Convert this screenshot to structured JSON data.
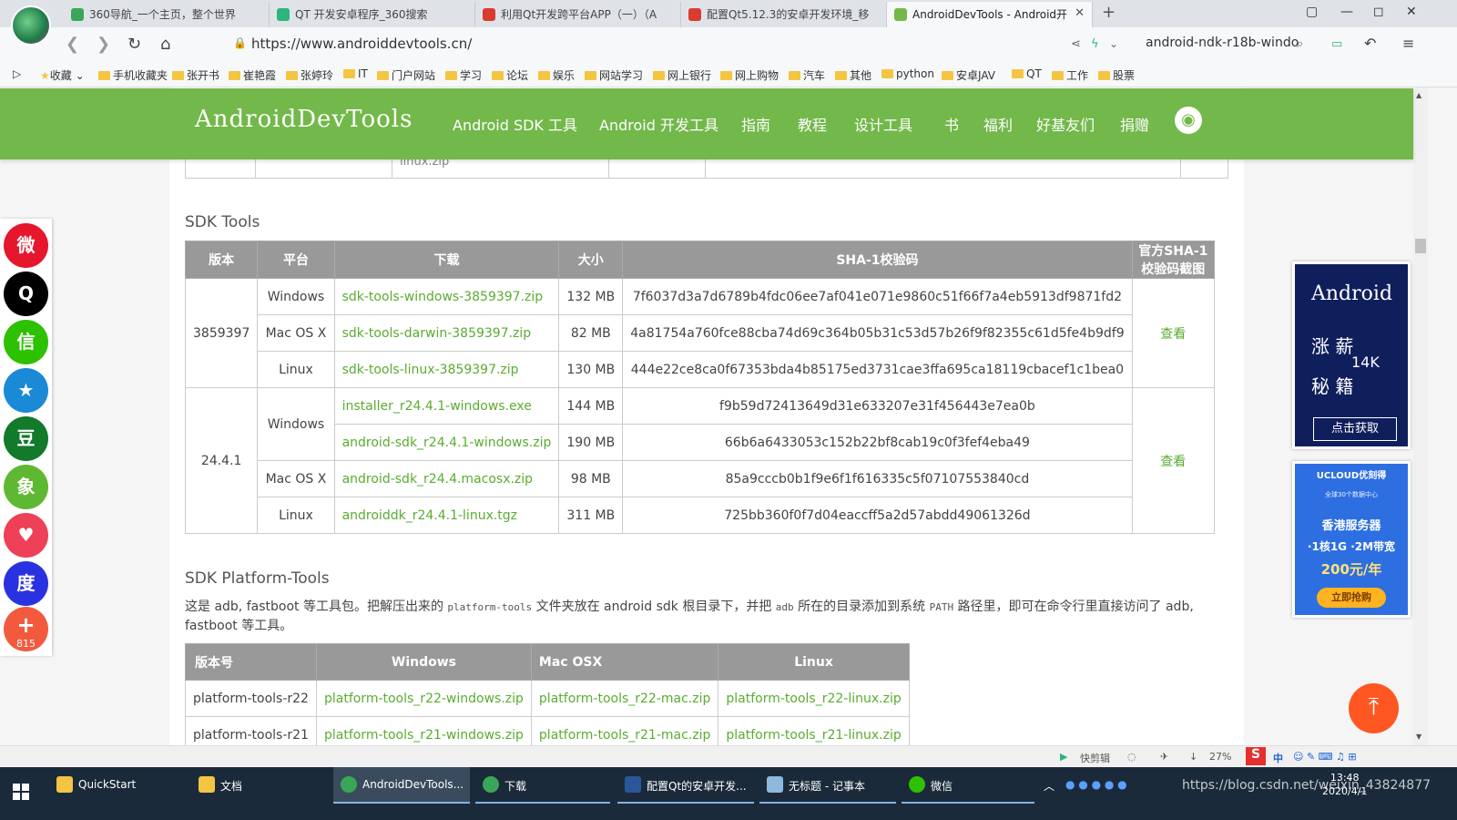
{
  "browser": {
    "tabs": [
      {
        "title": "360导航_一个主页，整个世界",
        "color": "#3aa657"
      },
      {
        "title": "QT 开发安卓程序_360搜索",
        "color": "#2bb67b"
      },
      {
        "title": "利用Qt开发跨平台APP（一）（A",
        "color": "#d93b2f"
      },
      {
        "title": "配置Qt5.12.3的安卓开发环境_移",
        "color": "#d93b2f"
      },
      {
        "title": "AndroidDevTools - Android开",
        "color": "#72b84a"
      }
    ],
    "url": "https://www.androiddevtools.cn/",
    "search_text": "android-ndk-r18b-windo",
    "bookmarks": [
      "收藏",
      "手机收藏夹",
      "张开书",
      "崔艳霞",
      "张婷玲",
      "IT",
      "门户网站",
      "学习",
      "论坛",
      "娱乐",
      "网站学习",
      "网上银行",
      "网上购物",
      "汽车",
      "其他",
      "python",
      "安卓JAV",
      "QT",
      "工作",
      "股票"
    ]
  },
  "site": {
    "logo": "AndroidDevTools",
    "nav": [
      "Android SDK 工具",
      "Android 开发工具",
      "指南",
      "教程",
      "设计工具",
      "书",
      "福利",
      "好基友们",
      "捐赠"
    ],
    "github_icon": "github-icon"
  },
  "prev_table_tail": "linux.zip",
  "sdk_tools": {
    "heading": "SDK Tools",
    "headers": [
      "版本",
      "平台",
      "下载",
      "大小",
      "SHA-1校验码",
      "官方SHA-1校验码截图"
    ],
    "view_label": "查看",
    "groups": [
      {
        "version": "3859397",
        "rows": [
          {
            "platform": "Windows",
            "file": "sdk-tools-windows-3859397.zip",
            "size": "132 MB",
            "sha": "7f6037d3a7d6789b4fdc06ee7af041e071e9860c51f66f7a4eb5913df9871fd2"
          },
          {
            "platform": "Mac OS X",
            "file": "sdk-tools-darwin-3859397.zip",
            "size": "82 MB",
            "sha": "4a81754a760fce88cba74d69c364b05b31c53d57b26f9f82355c61d5fe4b9df9"
          },
          {
            "platform": "Linux",
            "file": "sdk-tools-linux-3859397.zip",
            "size": "130 MB",
            "sha": "444e22ce8ca0f67353bda4b85175ed3731cae3ffa695ca18119cbacef1c1bea0"
          }
        ]
      },
      {
        "version": "24.4.1",
        "rows": [
          {
            "platform": "Windows",
            "file": "installer_r24.4.1-windows.exe",
            "size": "144 MB",
            "sha": "f9b59d72413649d31e633207e31f456443e7ea0b"
          },
          {
            "platform": "",
            "file": "android-sdk_r24.4.1-windows.zip",
            "size": "190 MB",
            "sha": "66b6a6433053c152b22bf8cab19c0f3fef4eba49"
          },
          {
            "platform": "Mac OS X",
            "file": "android-sdk_r24.4.macosx.zip",
            "size": "98 MB",
            "sha": "85a9cccb0b1f9e6f1f616335c5f07107553840cd"
          },
          {
            "platform": "Linux",
            "file": "androiddk_r24.4.1-linux.tgz",
            "size": "311 MB",
            "sha": "725bb360f0f7d04eaccff5a2d57abdd49061326d"
          }
        ]
      }
    ]
  },
  "platform_tools": {
    "heading": "SDK Platform-Tools",
    "desc_1": "这是 adb, fastboot 等工具包。把解压出来的 ",
    "code_1": "platform-tools",
    "desc_2": " 文件夹放在 android sdk 根目录下，并把 ",
    "code_2": "adb",
    "desc_3": " 所在的目录添加到系统 ",
    "code_3": "PATH",
    "desc_4": " 路径里，即可在命令行里直接访问了 adb, fastboot 等工具。",
    "headers": [
      "版本号",
      "Windows",
      "Mac OSX",
      "Linux"
    ],
    "rows": [
      {
        "version": "platform-tools-r22",
        "win": "platform-tools_r22-windows.zip",
        "mac": "platform-tools_r22-mac.zip",
        "linux": "platform-tools_r22-linux.zip"
      },
      {
        "version": "platform-tools-r21",
        "win": "platform-tools_r21-windows.zip",
        "mac": "platform-tools_r21-mac.zip",
        "linux": "platform-tools_r21-linux.zip"
      }
    ]
  },
  "share": {
    "count": "815",
    "icons": [
      {
        "name": "weibo-share-icon",
        "color": "#e6162d",
        "glyph": "微"
      },
      {
        "name": "qq-share-icon",
        "color": "#000000",
        "glyph": "Q"
      },
      {
        "name": "wechat-share-icon",
        "color": "#2dc100",
        "glyph": "信"
      },
      {
        "name": "qzone-share-icon",
        "color": "#1a8ad6",
        "glyph": "★"
      },
      {
        "name": "douban-share-icon",
        "color": "#127a2a",
        "glyph": "豆"
      },
      {
        "name": "evernote-share-icon",
        "color": "#5fb832",
        "glyph": "象"
      },
      {
        "name": "pocket-share-icon",
        "color": "#ee4056",
        "glyph": "♥"
      },
      {
        "name": "baidu-share-icon",
        "color": "#2932e1",
        "glyph": "度"
      },
      {
        "name": "more-share-icon",
        "color": "#f25a3e",
        "glyph": "+"
      }
    ]
  },
  "ads": {
    "ad1_title": "Android",
    "ad1_line1": "涨 薪",
    "ad1_line2": "秘 籍",
    "ad1_k": "14K",
    "ad1_cta": "点击获取",
    "ad2_brand": "UCLOUD优刻得",
    "ad2_sub": "全球30个数据中心",
    "ad2_l1": "香港服务器",
    "ad2_l2": "·1核1G ·2M带宽",
    "ad2_l3": "200元/年",
    "ad2_cta": "立即抢购"
  },
  "statusbar": {
    "items": [
      "快剪辑",
      "27%"
    ],
    "ime": "中"
  },
  "taskbar": {
    "tasks": [
      {
        "label": "QuickStart",
        "color": "#f4c542"
      },
      {
        "label": "文档",
        "color": "#f4c542"
      },
      {
        "label": "AndroidDevTools...",
        "color": "#3aa657"
      },
      {
        "label": "下载",
        "color": "#3aa657"
      },
      {
        "label": "配置Qt的安卓开发...",
        "color": "#2b579a"
      },
      {
        "label": "无标题 - 记事本",
        "color": "#8fb8de"
      },
      {
        "label": "微信",
        "color": "#2dc100"
      }
    ],
    "time": "13:48",
    "date": "2020/4/1",
    "watermark": "https://blog.csdn.net/weixin_43824877"
  }
}
